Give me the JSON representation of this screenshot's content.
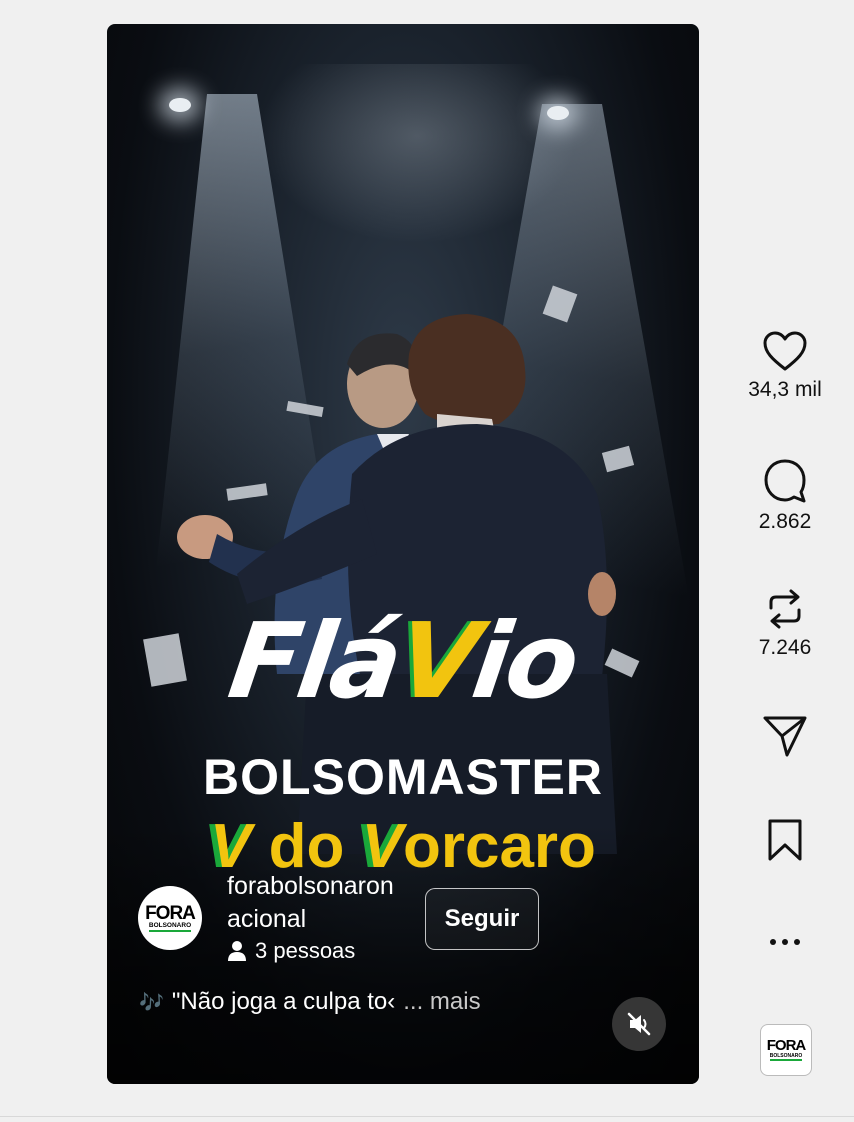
{
  "reel": {
    "title_script_part1": "Flá",
    "title_script_accent": "V",
    "title_script_part2": "io",
    "title_block": "BOLSOMASTER",
    "title_yellow_v1": "V",
    "title_yellow_middle": " do ",
    "title_yellow_v2": "V",
    "title_yellow_end": "orcaro"
  },
  "author": {
    "username": "forabolsonaronacional",
    "people_text": "3 pessoas",
    "follow_label": "Seguir",
    "avatar_logo_big": "FORA",
    "avatar_logo_small": "BOLSONARO"
  },
  "audio": {
    "note_icon": "🎶",
    "text": "\"Não joga a culpa to‹",
    "ellipsis_more": "... mais"
  },
  "actions": {
    "like_count": "34,3 mil",
    "comment_count": "2.862",
    "repost_count": "7.246"
  },
  "colors": {
    "accent_yellow": "#f2c40f",
    "accent_green": "#1aa83a"
  },
  "icons": [
    "heart-icon",
    "comment-icon",
    "repost-icon",
    "share-icon",
    "bookmark-icon",
    "more-icon",
    "mute-icon",
    "person-icon",
    "music-note-icon"
  ]
}
